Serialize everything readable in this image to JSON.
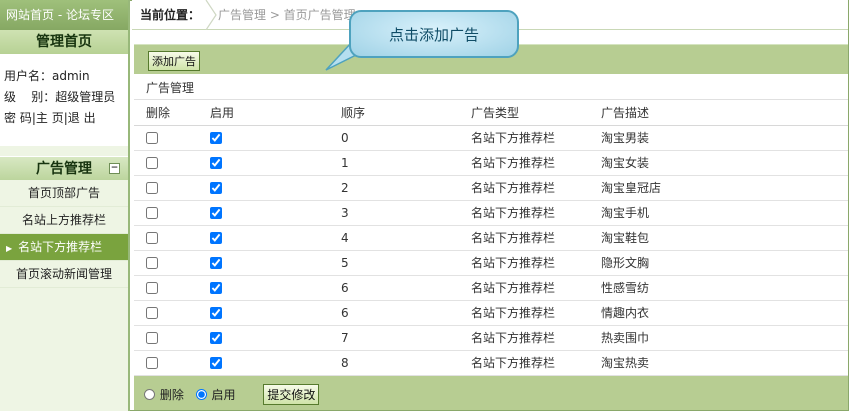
{
  "sidebar": {
    "top_link": "网站首页 - 论坛专区",
    "header": "管理首页",
    "user": {
      "username_label": "用户名：",
      "username": "admin",
      "level_label": "级    别：",
      "level": "超级管理员",
      "links": [
        "密 码",
        "主 页",
        "退 出"
      ]
    },
    "section_title": "广告管理",
    "collapse_glyph": "−",
    "items": [
      {
        "label": "首页顶部广告",
        "active": false
      },
      {
        "label": "名站上方推荐栏",
        "active": false
      },
      {
        "label": "名站下方推荐栏",
        "active": true
      },
      {
        "label": "首页滚动新闻管理",
        "active": false
      }
    ]
  },
  "header": {
    "breadcrumb_label": "当前位置：",
    "breadcrumb_path": "广告管理 > 首页广告管理"
  },
  "toolbar": {
    "add_button": "添加广告",
    "callout": "点击添加广告"
  },
  "table": {
    "title": "广告管理",
    "columns": [
      "删除",
      "启用",
      "顺序",
      "广告类型",
      "广告描述"
    ],
    "rows": [
      {
        "delete": false,
        "enabled": true,
        "order": "0",
        "type": "名站下方推荐栏",
        "desc": "淘宝男装"
      },
      {
        "delete": false,
        "enabled": true,
        "order": "1",
        "type": "名站下方推荐栏",
        "desc": "淘宝女装"
      },
      {
        "delete": false,
        "enabled": true,
        "order": "2",
        "type": "名站下方推荐栏",
        "desc": "淘宝皇冠店"
      },
      {
        "delete": false,
        "enabled": true,
        "order": "3",
        "type": "名站下方推荐栏",
        "desc": "淘宝手机"
      },
      {
        "delete": false,
        "enabled": true,
        "order": "4",
        "type": "名站下方推荐栏",
        "desc": "淘宝鞋包"
      },
      {
        "delete": false,
        "enabled": true,
        "order": "5",
        "type": "名站下方推荐栏",
        "desc": "隐形文胸"
      },
      {
        "delete": false,
        "enabled": true,
        "order": "6",
        "type": "名站下方推荐栏",
        "desc": "性感雪纺"
      },
      {
        "delete": false,
        "enabled": true,
        "order": "6",
        "type": "名站下方推荐栏",
        "desc": "情趣内衣"
      },
      {
        "delete": false,
        "enabled": true,
        "order": "7",
        "type": "名站下方推荐栏",
        "desc": "热卖围巾"
      },
      {
        "delete": false,
        "enabled": true,
        "order": "8",
        "type": "名站下方推荐栏",
        "desc": "淘宝热卖"
      }
    ]
  },
  "footer": {
    "radio_delete": "删除",
    "radio_enable": "启用",
    "selected": "enable",
    "submit": "提交修改"
  },
  "colors": {
    "accent": "#7aa33e",
    "toolbar_bg": "#b7cd92",
    "callout_border": "#4ea2be"
  }
}
